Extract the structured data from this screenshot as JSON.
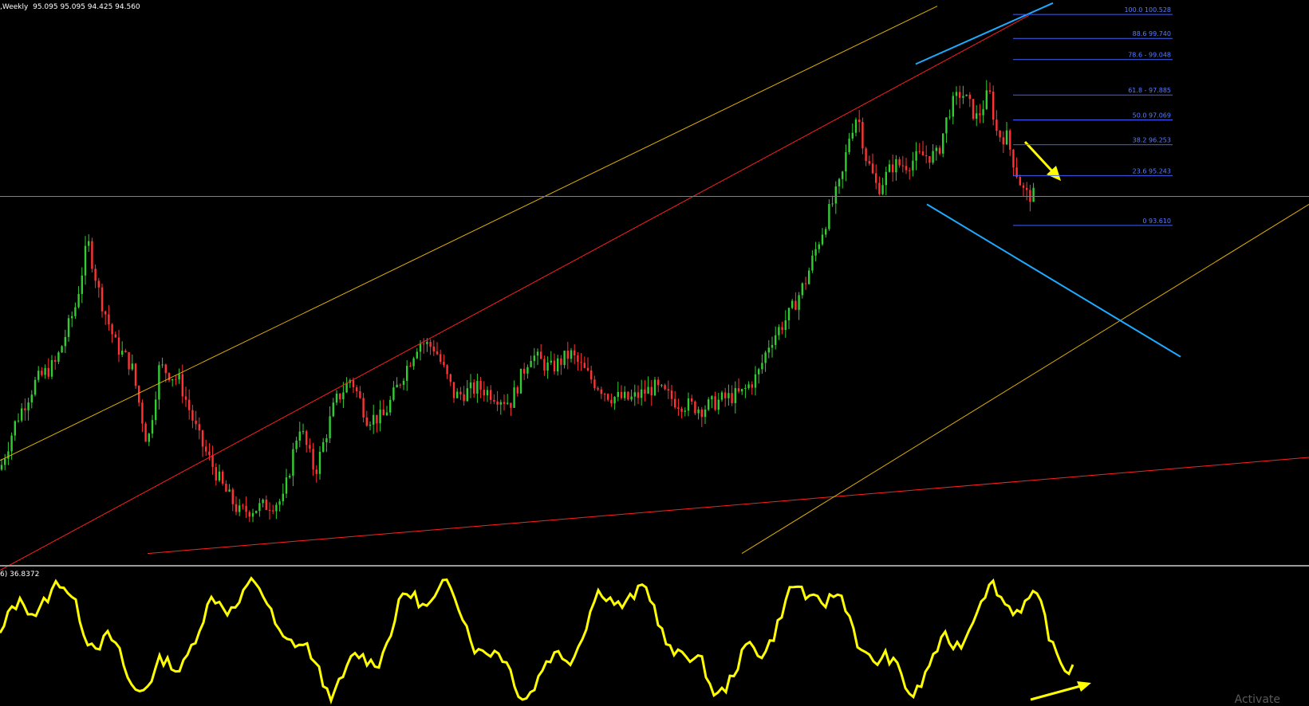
{
  "header": {
    "symbol_timeframe": ",Weekly",
    "ohlc": "95.095 95.095 94.425 94.560"
  },
  "indicator": {
    "label": "6) 36.8372",
    "color": "#ffff00"
  },
  "watermark": "Activate",
  "colors": {
    "background": "#000000",
    "bull_candle": "#33cc33",
    "bear_candle": "#ff3333",
    "red_channel": "#ff2020",
    "yellow_channel": "#e0b000",
    "blue_channel": "#1eaaff",
    "fib_lines": "#4060ff",
    "arrow": "#ffff00",
    "price_line": "#808080"
  },
  "chart_data": {
    "type": "candlestick",
    "timeframe": "Weekly",
    "y_range": [
      82.5,
      101.0
    ],
    "current_price": 94.56,
    "fibonacci": [
      {
        "level": "100.0",
        "price": 100.528,
        "label": "100.0 100.528"
      },
      {
        "level": "88.6",
        "price": 99.74,
        "label": "88.6 99.740"
      },
      {
        "level": "78.6",
        "price": 99.048,
        "label": "78.6 - 99.048"
      },
      {
        "level": "61.8",
        "price": 97.885,
        "label": "61.8 - 97.885"
      },
      {
        "level": "50.0",
        "price": 97.069,
        "label": "50.0 97.069"
      },
      {
        "level": "38.2",
        "price": 96.253,
        "label": "38.2 96.253"
      },
      {
        "level": "23.6",
        "price": 95.243,
        "label": "23.6 95.243"
      },
      {
        "level": "0",
        "price": 93.61,
        "label": "0 93.610"
      }
    ],
    "indicator_last_value": 36.8372
  }
}
